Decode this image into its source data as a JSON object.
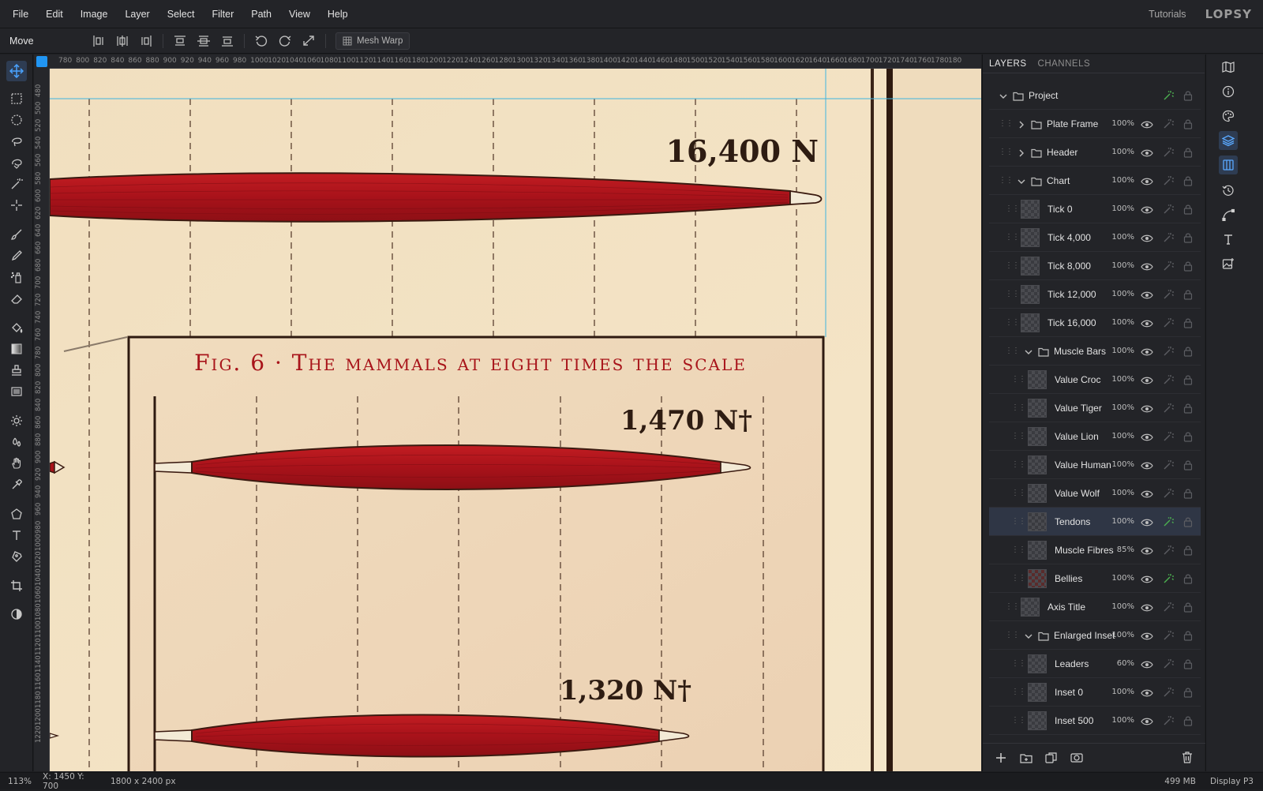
{
  "menu": [
    "File",
    "Edit",
    "Image",
    "Layer",
    "Select",
    "Filter",
    "Path",
    "View",
    "Help"
  ],
  "header": {
    "tutorials": "Tutorials",
    "logo": "LOPSY"
  },
  "options": {
    "tool_name": "Move",
    "mesh_warp": "Mesh Warp"
  },
  "rulers": {
    "top": [
      "780",
      "800",
      "820",
      "840",
      "860",
      "880",
      "900",
      "920",
      "940",
      "960",
      "980",
      "1000",
      "1020",
      "1040",
      "1060",
      "1080",
      "1100",
      "1120",
      "1140",
      "1160",
      "1180",
      "1200",
      "1220",
      "1240",
      "1260",
      "1280",
      "1300",
      "1320",
      "1340",
      "1360",
      "1380",
      "1400",
      "1420",
      "1440",
      "1460",
      "1480",
      "1500",
      "1520",
      "1540",
      "1560",
      "1580",
      "1600",
      "1620",
      "1640",
      "1660",
      "1680",
      "1700",
      "1720",
      "1740",
      "1760",
      "1780",
      "180"
    ],
    "left": [
      "480",
      "500",
      "520",
      "540",
      "560",
      "580",
      "600",
      "620",
      "640",
      "660",
      "680",
      "700",
      "720",
      "740",
      "760",
      "780",
      "800",
      "820",
      "840",
      "860",
      "880",
      "900",
      "920",
      "940",
      "960",
      "980",
      "1000",
      "1020",
      "1040",
      "1060",
      "1080",
      "1100",
      "1120",
      "1140",
      "1160",
      "1180",
      "1200",
      "1220"
    ]
  },
  "artwork": {
    "main_value": "16,400 N",
    "inset_title": "Fig. 6 · The mammals at eight times the scale",
    "inset_value_1": "1,470 N†",
    "inset_value_2": "1,320 N†",
    "bar_color": "#b3151b",
    "paper_color": "#f3e3c4"
  },
  "panel": {
    "tabs": [
      "LAYERS",
      "CHANNELS"
    ],
    "layers": [
      {
        "name": "Project",
        "depth": 0,
        "kind": "folder",
        "open": true,
        "opacity": "",
        "fx": true
      },
      {
        "name": "Plate Frame",
        "depth": 1,
        "kind": "folder",
        "open": false,
        "opacity": "100%",
        "fx": false
      },
      {
        "name": "Header",
        "depth": 1,
        "kind": "folder",
        "open": false,
        "opacity": "100%",
        "fx": false
      },
      {
        "name": "Chart",
        "depth": 1,
        "kind": "folder",
        "open": true,
        "opacity": "100%",
        "fx": false
      },
      {
        "name": "Tick 0",
        "depth": 2,
        "kind": "layer",
        "opacity": "100%",
        "fx": false
      },
      {
        "name": "Tick 4,000",
        "depth": 2,
        "kind": "layer",
        "opacity": "100%",
        "fx": false
      },
      {
        "name": "Tick 8,000",
        "depth": 2,
        "kind": "layer",
        "opacity": "100%",
        "fx": false
      },
      {
        "name": "Tick 12,000",
        "depth": 2,
        "kind": "layer",
        "opacity": "100%",
        "fx": false
      },
      {
        "name": "Tick 16,000",
        "depth": 2,
        "kind": "layer",
        "opacity": "100%",
        "fx": false
      },
      {
        "name": "Muscle Bars",
        "depth": 2,
        "kind": "folder",
        "open": true,
        "opacity": "100%",
        "fx": false
      },
      {
        "name": "Value Croc",
        "depth": 3,
        "kind": "layer",
        "opacity": "100%",
        "fx": false
      },
      {
        "name": "Value Tiger",
        "depth": 3,
        "kind": "layer",
        "opacity": "100%",
        "fx": false
      },
      {
        "name": "Value Lion",
        "depth": 3,
        "kind": "layer",
        "opacity": "100%",
        "fx": false
      },
      {
        "name": "Value Human",
        "depth": 3,
        "kind": "layer",
        "opacity": "100%",
        "fx": false
      },
      {
        "name": "Value Wolf",
        "depth": 3,
        "kind": "layer",
        "opacity": "100%",
        "fx": false
      },
      {
        "name": "Tendons",
        "depth": 3,
        "kind": "layer",
        "opacity": "100%",
        "fx": true,
        "selected": true
      },
      {
        "name": "Muscle Fibres",
        "depth": 3,
        "kind": "layer",
        "opacity": "85%",
        "fx": false
      },
      {
        "name": "Bellies",
        "depth": 3,
        "kind": "layer",
        "opacity": "100%",
        "fx": true
      },
      {
        "name": "Axis Title",
        "depth": 2,
        "kind": "layer",
        "opacity": "100%",
        "fx": false
      },
      {
        "name": "Enlarged Inset",
        "depth": 2,
        "kind": "folder",
        "open": true,
        "opacity": "100%",
        "fx": false
      },
      {
        "name": "Leaders",
        "depth": 3,
        "kind": "layer",
        "opacity": "60%",
        "fx": false
      },
      {
        "name": "Inset 0",
        "depth": 3,
        "kind": "layer",
        "opacity": "100%",
        "fx": false
      },
      {
        "name": "Inset 500",
        "depth": 3,
        "kind": "layer",
        "opacity": "100%",
        "fx": false
      }
    ]
  },
  "status": {
    "zoom": "113%",
    "coords": "X: 1450 Y: 700",
    "dims": "1800 x 2400 px",
    "memory": "499 MB",
    "profile": "Display P3"
  },
  "colors": {
    "accent": "#2196f3",
    "fx_active": "#4caf50"
  }
}
